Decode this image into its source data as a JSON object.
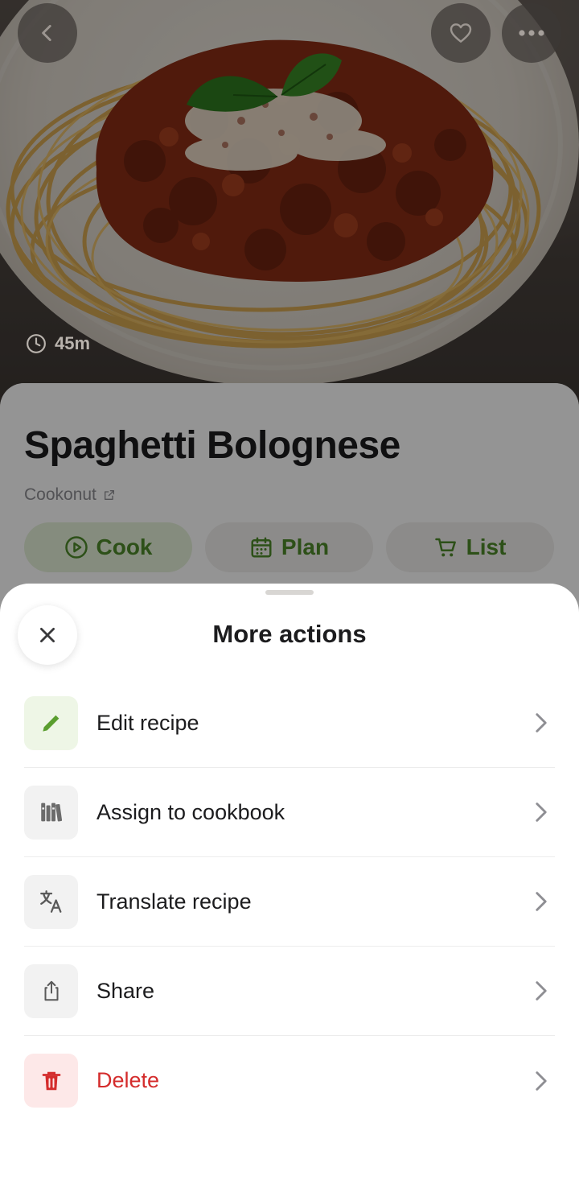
{
  "hero": {
    "image_alt": "Spaghetti bolognese on a plate",
    "time": "45m",
    "buttons": {
      "back": "chevron-left-icon",
      "favorite": "heart-icon",
      "more": "ellipsis-icon"
    }
  },
  "recipe": {
    "title": "Spaghetti Bolognese",
    "source": "Cookonut",
    "actions": [
      {
        "label": "Cook",
        "icon": "play-circle-icon"
      },
      {
        "label": "Plan",
        "icon": "calendar-icon"
      },
      {
        "label": "List",
        "icon": "cart-icon"
      }
    ]
  },
  "sheet": {
    "title": "More actions",
    "items": [
      {
        "label": "Edit recipe",
        "icon": "pencil-icon"
      },
      {
        "label": "Assign to cookbook",
        "icon": "books-icon"
      },
      {
        "label": "Translate recipe",
        "icon": "translate-icon"
      },
      {
        "label": "Share",
        "icon": "share-icon"
      },
      {
        "label": "Delete",
        "icon": "trash-icon"
      }
    ]
  },
  "colors": {
    "accent_green": "#4e8a2a",
    "danger_red": "#d42c2c"
  }
}
